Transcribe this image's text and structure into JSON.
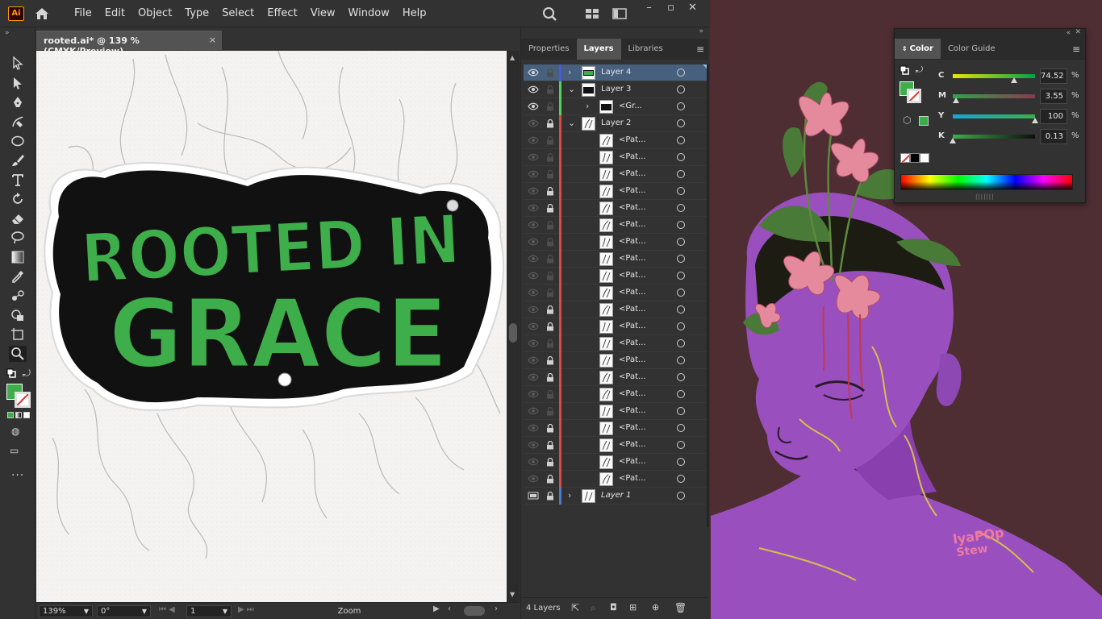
{
  "app": {
    "logo": "Ai"
  },
  "menu": [
    "File",
    "Edit",
    "Object",
    "Type",
    "Select",
    "Effect",
    "View",
    "Window",
    "Help"
  ],
  "document": {
    "tab_title": "rooted.ai* @ 139 % (CMYK/Preview)",
    "close_glyph": "×"
  },
  "artboard_text": {
    "line1": "ROOTED IN",
    "line2": "GRACE"
  },
  "statusbar": {
    "zoom": "139%",
    "rotation": "0°",
    "artboard": "1",
    "mode": "Zoom"
  },
  "layers_panel": {
    "tabs": [
      "Properties",
      "Layers",
      "Libraries"
    ],
    "active_tab": "Layers",
    "rows": [
      {
        "name": "Layer 4",
        "indent": 0,
        "twirl": "›",
        "visible": true,
        "locked": false,
        "color": "#4a5ad8",
        "selected": true
      },
      {
        "name": "Layer 3",
        "indent": 0,
        "twirl": "⌄",
        "visible": true,
        "locked": false,
        "color": "#4fd45a",
        "selected": false
      },
      {
        "name": "<Gr...",
        "indent": 1,
        "twirl": "›",
        "visible": true,
        "locked": false,
        "color": "#4fd45a",
        "selected": false
      },
      {
        "name": "Layer 2",
        "indent": 0,
        "twirl": "⌄",
        "visible": false,
        "locked": true,
        "color": "#e04848",
        "selected": false
      },
      {
        "name": "<Pat...",
        "indent": 1,
        "twirl": "",
        "visible": false,
        "locked": false,
        "color": "#e04848",
        "selected": false
      },
      {
        "name": "<Pat...",
        "indent": 1,
        "twirl": "",
        "visible": false,
        "locked": false,
        "color": "#e04848",
        "selected": false
      },
      {
        "name": "<Pat...",
        "indent": 1,
        "twirl": "",
        "visible": false,
        "locked": false,
        "color": "#e04848",
        "selected": false
      },
      {
        "name": "<Pat...",
        "indent": 1,
        "twirl": "",
        "visible": false,
        "locked": true,
        "color": "#e04848",
        "selected": false
      },
      {
        "name": "<Pat...",
        "indent": 1,
        "twirl": "",
        "visible": false,
        "locked": true,
        "color": "#e04848",
        "selected": false
      },
      {
        "name": "<Pat...",
        "indent": 1,
        "twirl": "",
        "visible": false,
        "locked": false,
        "color": "#e04848",
        "selected": false
      },
      {
        "name": "<Pat...",
        "indent": 1,
        "twirl": "",
        "visible": false,
        "locked": false,
        "color": "#e04848",
        "selected": false
      },
      {
        "name": "<Pat...",
        "indent": 1,
        "twirl": "",
        "visible": false,
        "locked": false,
        "color": "#e04848",
        "selected": false
      },
      {
        "name": "<Pat...",
        "indent": 1,
        "twirl": "",
        "visible": false,
        "locked": false,
        "color": "#e04848",
        "selected": false
      },
      {
        "name": "<Pat...",
        "indent": 1,
        "twirl": "",
        "visible": false,
        "locked": false,
        "color": "#e04848",
        "selected": false
      },
      {
        "name": "<Pat...",
        "indent": 1,
        "twirl": "",
        "visible": false,
        "locked": true,
        "color": "#e04848",
        "selected": false
      },
      {
        "name": "<Pat...",
        "indent": 1,
        "twirl": "",
        "visible": false,
        "locked": true,
        "color": "#e04848",
        "selected": false
      },
      {
        "name": "<Pat...",
        "indent": 1,
        "twirl": "",
        "visible": false,
        "locked": false,
        "color": "#e04848",
        "selected": false
      },
      {
        "name": "<Pat...",
        "indent": 1,
        "twirl": "",
        "visible": false,
        "locked": true,
        "color": "#e04848",
        "selected": false
      },
      {
        "name": "<Pat...",
        "indent": 1,
        "twirl": "",
        "visible": false,
        "locked": true,
        "color": "#e04848",
        "selected": false
      },
      {
        "name": "<Pat...",
        "indent": 1,
        "twirl": "",
        "visible": false,
        "locked": false,
        "color": "#e04848",
        "selected": false
      },
      {
        "name": "<Pat...",
        "indent": 1,
        "twirl": "",
        "visible": false,
        "locked": false,
        "color": "#e04848",
        "selected": false
      },
      {
        "name": "<Pat...",
        "indent": 1,
        "twirl": "",
        "visible": false,
        "locked": true,
        "color": "#e04848",
        "selected": false
      },
      {
        "name": "<Pat...",
        "indent": 1,
        "twirl": "",
        "visible": false,
        "locked": true,
        "color": "#e04848",
        "selected": false
      },
      {
        "name": "<Pat...",
        "indent": 1,
        "twirl": "",
        "visible": false,
        "locked": true,
        "color": "#e04848",
        "selected": false
      },
      {
        "name": "<Pat...",
        "indent": 1,
        "twirl": "",
        "visible": false,
        "locked": true,
        "color": "#e04848",
        "selected": false
      },
      {
        "name": "Layer 1",
        "indent": 0,
        "twirl": "›",
        "visible": false,
        "locked": true,
        "color": "#4a7ad8",
        "selected": false,
        "template": true
      }
    ],
    "count_label": "4 Layers"
  },
  "color_panel": {
    "tabs": [
      "Color",
      "Color Guide"
    ],
    "active_tab": "Color",
    "fill_color": "#3dae4a",
    "channels": [
      {
        "label": "C",
        "value": "74.52",
        "unit": "%",
        "level": 0.7452,
        "grad_from": "#e8e800",
        "grad_to": "#00a04a"
      },
      {
        "label": "M",
        "value": "3.55",
        "unit": "%",
        "level": 0.0355,
        "grad_from": "#2fa44a",
        "grad_to": "#8a3a50"
      },
      {
        "label": "Y",
        "value": "100",
        "unit": "%",
        "level": 1.0,
        "grad_from": "#1aa6d4",
        "grad_to": "#3dae4a"
      },
      {
        "label": "K",
        "value": "0.13",
        "unit": "%",
        "level": 0.0013,
        "grad_from": "#3dae4a",
        "grad_to": "#0d0d0d"
      }
    ]
  },
  "colors": {
    "ui_bg": "#323232",
    "text_green": "#3dae4a",
    "artwork_bg": "#4e2d33",
    "skin_purple": "#9a4fbf"
  }
}
